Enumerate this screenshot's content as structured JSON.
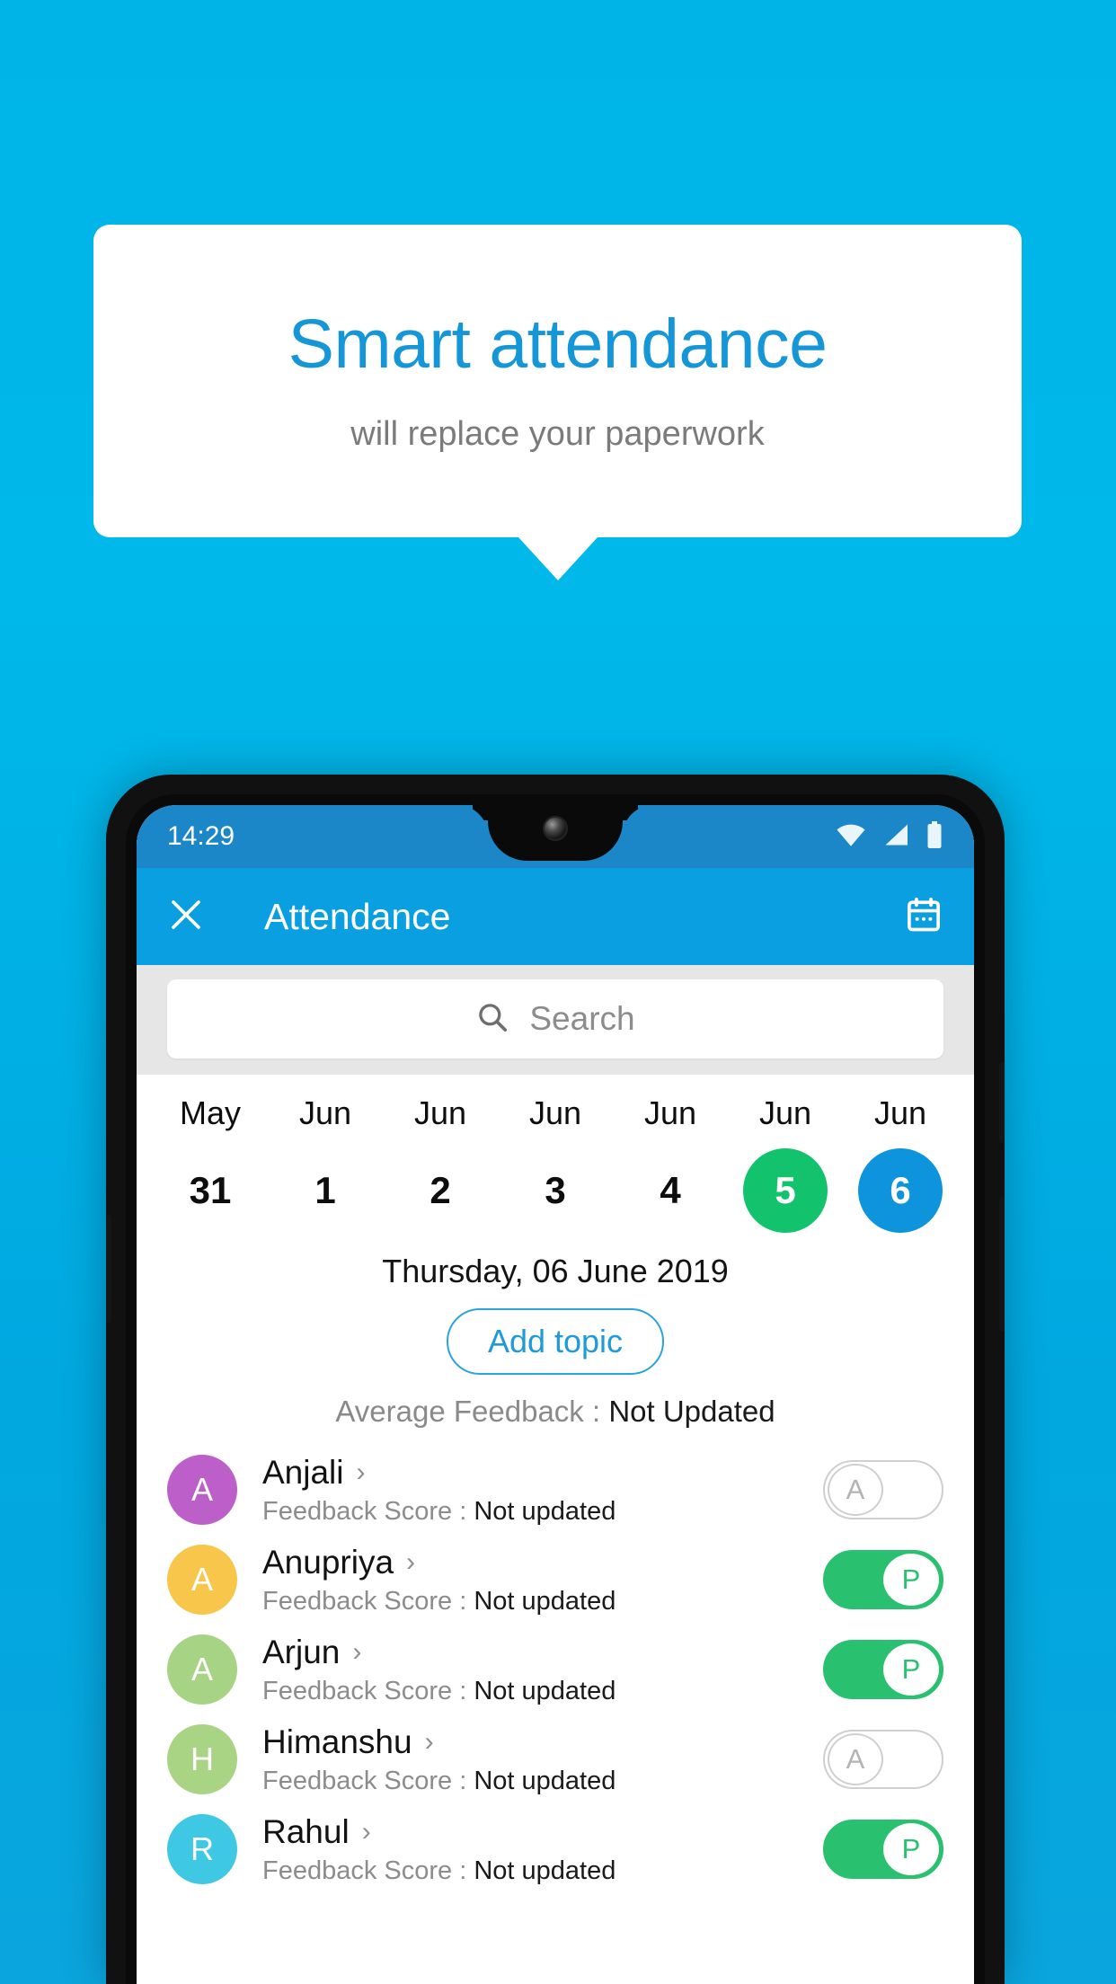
{
  "promo": {
    "title": "Smart attendance",
    "subtitle": "will replace your paperwork"
  },
  "phone": {
    "statusbar": {
      "time": "14:29",
      "icons": [
        "wifi-icon",
        "signal-icon",
        "battery-icon"
      ]
    },
    "appbar": {
      "close_label": "✕",
      "title": "Attendance",
      "calendar_icon": "calendar-icon"
    },
    "search": {
      "placeholder": "Search",
      "icon": "search-icon"
    },
    "date_strip": [
      {
        "month": "May",
        "day": "31",
        "state": "normal"
      },
      {
        "month": "Jun",
        "day": "1",
        "state": "normal"
      },
      {
        "month": "Jun",
        "day": "2",
        "state": "normal"
      },
      {
        "month": "Jun",
        "day": "3",
        "state": "normal"
      },
      {
        "month": "Jun",
        "day": "4",
        "state": "normal"
      },
      {
        "month": "Jun",
        "day": "5",
        "state": "green"
      },
      {
        "month": "Jun",
        "day": "6",
        "state": "blue"
      }
    ],
    "selected_date_heading": "Thursday, 06 June 2019",
    "add_topic_label": "Add topic",
    "average_feedback_label": "Average Feedback : ",
    "average_feedback_value": "Not Updated",
    "feedback_score_label": "Feedback Score : ",
    "students": [
      {
        "name": "Anjali",
        "initial": "A",
        "avatar_color": "#bc5fc9",
        "score": "Not updated",
        "status": "A",
        "present": false
      },
      {
        "name": "Anupriya",
        "initial": "A",
        "avatar_color": "#f7c64a",
        "score": "Not updated",
        "status": "P",
        "present": true
      },
      {
        "name": "Arjun",
        "initial": "A",
        "avatar_color": "#a6d384",
        "score": "Not updated",
        "status": "P",
        "present": true
      },
      {
        "name": "Himanshu",
        "initial": "H",
        "avatar_color": "#a8d484",
        "score": "Not updated",
        "status": "A",
        "present": false
      },
      {
        "name": "Rahul",
        "initial": "R",
        "avatar_color": "#3fc8e4",
        "score": "Not updated",
        "status": "P",
        "present": true
      }
    ]
  },
  "colors": {
    "background": "#00b4e8",
    "accent_blue": "#1496d8",
    "appbar_blue": "#0a9fe0",
    "statusbar_blue": "#1b87c9",
    "present_green": "#29c16f",
    "selected_green": "#12c26c",
    "selected_blue": "#0e94dd"
  }
}
